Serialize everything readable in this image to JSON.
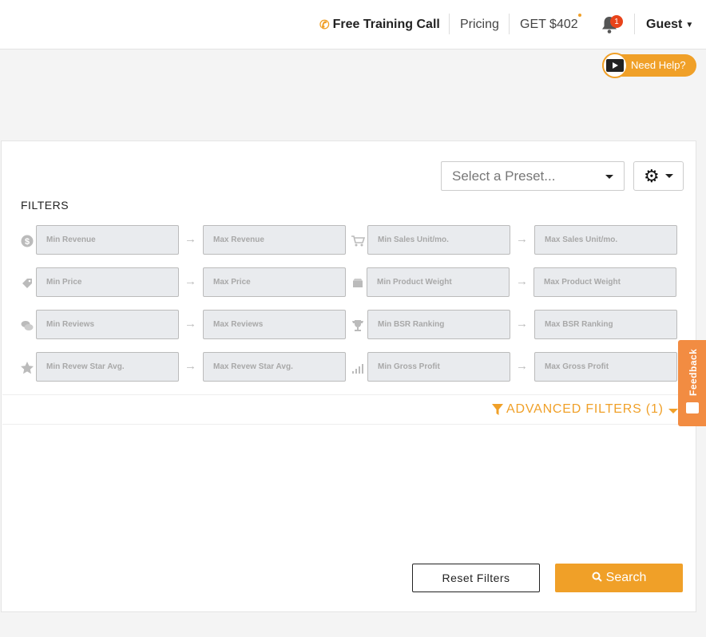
{
  "nav": {
    "training": "Free Training Call",
    "pricing": "Pricing",
    "offer": "GET $402",
    "notifications_count": "1",
    "user": "Guest"
  },
  "help": {
    "label": "Need Help?"
  },
  "preset": {
    "placeholder": "Select a Preset..."
  },
  "filters": {
    "title": "FILTERS",
    "rows": [
      {
        "icon": "dollar-icon",
        "min": "Min Revenue",
        "max": "Max Revenue"
      },
      {
        "icon": "cart-icon",
        "min": "Min Sales Unit/mo.",
        "max": "Max Sales Unit/mo."
      },
      {
        "icon": "price-tag-icon",
        "min": "Min Price",
        "max": "Max Price"
      },
      {
        "icon": "box-icon",
        "min": "Min Product Weight",
        "max": "Max Product Weight"
      },
      {
        "icon": "reviews-icon",
        "min": "Min Reviews",
        "max": "Max Reviews"
      },
      {
        "icon": "trophy-icon",
        "min": "Min BSR Ranking",
        "max": "Max BSR Ranking"
      },
      {
        "icon": "star-icon",
        "min": "Min Revew Star Avg.",
        "max": "Max Revew Star Avg."
      },
      {
        "icon": "growth-chart-icon",
        "min": "Min Gross Profit",
        "max": "Max Gross Profit"
      }
    ]
  },
  "advanced": {
    "label": "ADVANCED FILTERS (1)"
  },
  "buttons": {
    "reset": "Reset Filters",
    "search": "Search"
  },
  "feedback": {
    "label": "Feedback"
  },
  "colors": {
    "accent": "#f0a028",
    "badge": "#e8431a",
    "feedback": "#f28c42"
  }
}
